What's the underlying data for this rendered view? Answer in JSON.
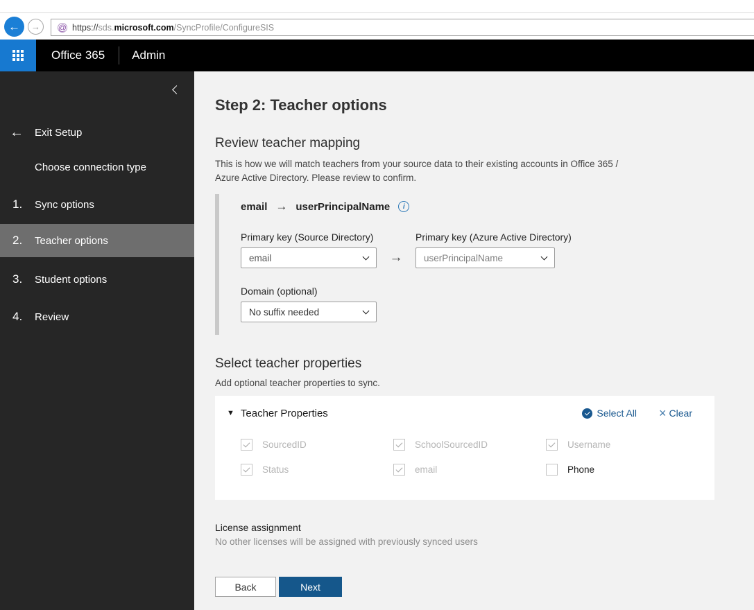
{
  "browser": {
    "url": {
      "scheme": "https://",
      "subdomain": "sds.",
      "domain": "microsoft.com",
      "path": "/SyncProfile/ConfigureSIS"
    }
  },
  "suite_bar": {
    "brand": "Office 365",
    "section": "Admin"
  },
  "sidebar": {
    "exit_label": "Exit Setup",
    "intro_item": "Choose connection type",
    "steps": [
      {
        "num": "1.",
        "label": "Sync options",
        "active": false
      },
      {
        "num": "2.",
        "label": "Teacher options",
        "active": true
      },
      {
        "num": "3.",
        "label": "Student options",
        "active": false
      },
      {
        "num": "4.",
        "label": "Review",
        "active": false
      }
    ]
  },
  "main": {
    "title": "Step 2: Teacher options",
    "mapping": {
      "heading": "Review teacher mapping",
      "description": "This is how we will match teachers from your source data to their existing accounts in Office 365 / Azure Active Directory. Please review to confirm.",
      "summary_source": "email",
      "summary_target": "userPrincipalName",
      "source_label": "Primary key (Source Directory)",
      "source_value": "email",
      "target_label": "Primary key (Azure Active Directory)",
      "target_value": "userPrincipalName",
      "domain_label": "Domain (optional)",
      "domain_value": "No suffix needed"
    },
    "properties": {
      "heading": "Select teacher properties",
      "description": "Add optional teacher properties to sync.",
      "group_label": "Teacher Properties",
      "select_all_label": "Select All",
      "clear_label": "Clear",
      "checkboxes": [
        {
          "label": "SourcedID",
          "checked": true,
          "disabled": true
        },
        {
          "label": "SchoolSourcedID",
          "checked": true,
          "disabled": true
        },
        {
          "label": "Username",
          "checked": true,
          "disabled": true
        },
        {
          "label": "Status",
          "checked": true,
          "disabled": true
        },
        {
          "label": "email",
          "checked": true,
          "disabled": true
        },
        {
          "label": "Phone",
          "checked": false,
          "disabled": false
        }
      ]
    },
    "license": {
      "heading": "License assignment",
      "description": "No other licenses will be assigned with previously synced users"
    },
    "actions": {
      "back": "Back",
      "next": "Next"
    }
  },
  "colors": {
    "launcher_blue": "#1779d0",
    "back_button_blue": "#1b7fd6",
    "link_blue": "#19588f",
    "next_button_blue": "#15578b",
    "info_blue": "#2e7ab8",
    "sidebar_bg": "#262626",
    "sidebar_active": "#6e6e6e"
  }
}
